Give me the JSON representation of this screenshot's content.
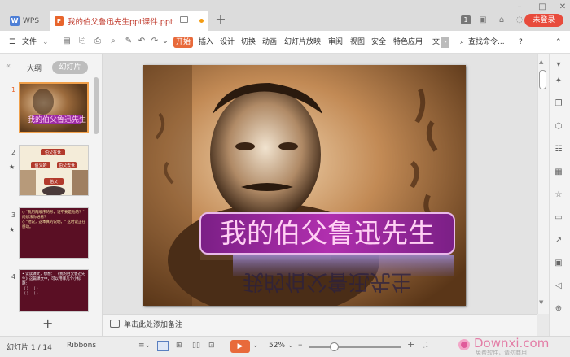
{
  "app": {
    "name": "WPS",
    "login": "未登录"
  },
  "document": {
    "title": "我的伯父鲁迅先生ppt课件.ppt",
    "unsaved_color": "#f39c12"
  },
  "menu": {
    "file": "文件",
    "tabs": [
      "开始",
      "插入",
      "设计",
      "切换",
      "动画",
      "幻灯片放映",
      "审阅",
      "视图",
      "安全",
      "特色应用",
      "文"
    ],
    "search": "查找命令..."
  },
  "left_panel": {
    "tab_outline": "大纲",
    "tab_slides": "幻灯片",
    "slide_numbers": [
      "1",
      "2",
      "3",
      "4"
    ],
    "thumb2_labels": [
      "伯父在世",
      "伯父的",
      "伯父去世",
      "伯父"
    ],
    "thumb3_text": "◇ \"我用两顺序的形，证不要是他的？\" 问想法你进看？\n◇ \"他说，这本真的说明，\" 这时说正在感动。",
    "thumb4_text": "• 读读课文，想想： 《我的伯父鲁迅先生》这篇课文中，可以用哪几个小标题：\n（ ） （ ）\n（ ） （ ）"
  },
  "slide": {
    "title": "我的伯父鲁迅先生",
    "reflection": "我的伯父鲁迅先生"
  },
  "notes": {
    "placeholder": "单击此处添加备注"
  },
  "status": {
    "slide_counter": "幻灯片 1 / 14",
    "theme": "Ribbons",
    "zoom": "52%"
  },
  "watermark": {
    "text": "Downxi.com",
    "sub": "免费软件，请勿商用"
  },
  "colors": {
    "accent": "#e86a3b",
    "login_bg": "#e84b3c",
    "title_pink": "#ff57c8"
  }
}
